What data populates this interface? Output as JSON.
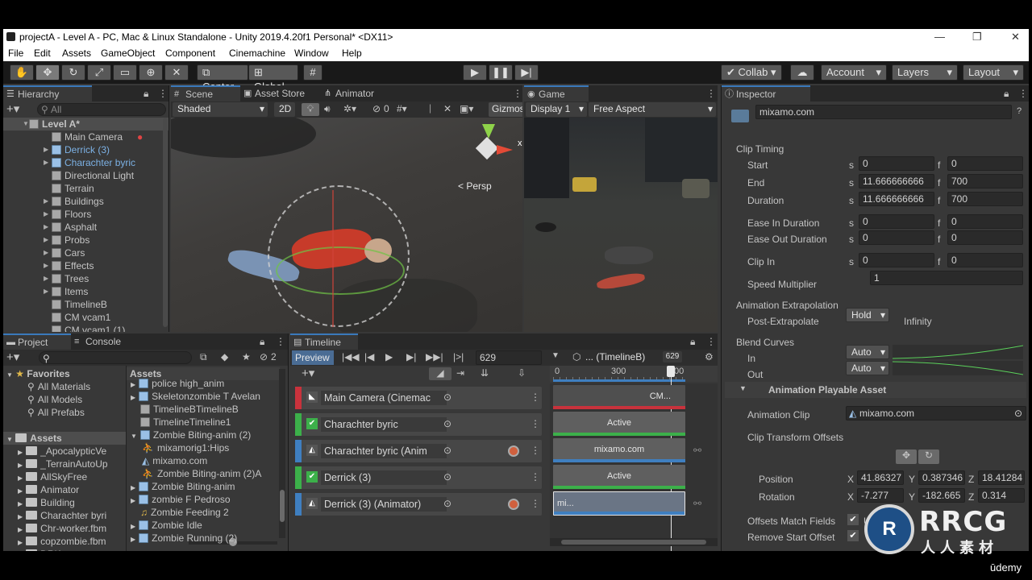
{
  "window": {
    "title": "projectA - Level A - PC, Mac & Linux Standalone - Unity 2019.4.20f1 Personal* <DX11>"
  },
  "menu": [
    "File",
    "Edit",
    "Assets",
    "GameObject",
    "Component",
    "Cinemachine",
    "Window",
    "Help"
  ],
  "toolbar": {
    "center": "Center",
    "global": "Global",
    "collab": "Collab",
    "account": "Account",
    "layers": "Layers",
    "layout": "Layout"
  },
  "hierarchy": {
    "tab": "Hierarchy",
    "search_placeholder": "All",
    "scene": "Level A*",
    "items": [
      {
        "label": "Main Camera",
        "type": "cam"
      },
      {
        "label": "Derrick (3)",
        "type": "prefab",
        "fold": true
      },
      {
        "label": "Charachter byric",
        "type": "prefab",
        "fold": true
      },
      {
        "label": "Directional Light",
        "type": "go"
      },
      {
        "label": "Terrain",
        "type": "go"
      },
      {
        "label": "Buildings",
        "type": "go",
        "fold": true
      },
      {
        "label": "Floors",
        "type": "go",
        "fold": true
      },
      {
        "label": "Asphalt",
        "type": "go",
        "fold": true
      },
      {
        "label": "Probs",
        "type": "go",
        "fold": true
      },
      {
        "label": "Cars",
        "type": "go",
        "fold": true
      },
      {
        "label": "Effects",
        "type": "go",
        "fold": true
      },
      {
        "label": "Trees",
        "type": "go",
        "fold": true
      },
      {
        "label": "Items",
        "type": "go",
        "fold": true
      },
      {
        "label": "TimelineB",
        "type": "go"
      },
      {
        "label": "CM vcam1",
        "type": "go"
      },
      {
        "label": "CM vcam1 (1)",
        "type": "go"
      }
    ]
  },
  "scene": {
    "tabs": [
      "Scene",
      "Asset Store",
      "Animator"
    ],
    "shading": "Shaded",
    "mode_2d": "2D",
    "hidden_count": "0",
    "gizmos": "Gizmos",
    "persp": "< Persp",
    "axis_y": "y",
    "axis_x": "x"
  },
  "game": {
    "tab": "Game",
    "display": "Display 1",
    "aspect": "Free Aspect"
  },
  "project": {
    "tabs": [
      "Project",
      "Console"
    ],
    "count": "2",
    "favorites_label": "Favorites",
    "favorites": [
      "All Materials",
      "All Models",
      "All Prefabs"
    ],
    "assets_root": "Assets",
    "tree": [
      "_ApocalypticVe",
      "_TerrainAutoUp",
      "AllSkyFree",
      "Animator",
      "Building",
      "Charachter byri",
      "Chr-worker.fbm",
      "copzombie.fbm",
      "DRK"
    ],
    "assets_header": "Assets",
    "assets": [
      "police high_anim",
      "Skeletonzombie T Avelan",
      "TimelineBTimelineB",
      "TimelineTimeline1",
      "Zombie Biting-anim (2)",
      "mixamorig1:Hips",
      "mixamo.com",
      "Zombie Biting-anim (2)A",
      "Zombie Biting-anim",
      "zombie F Pedroso",
      "Zombie Feeding 2",
      "Zombie Idle",
      "Zombie Running (2)"
    ]
  },
  "timeline": {
    "tab": "Timeline",
    "preview": "Preview",
    "frame": "629",
    "asset": "... (TimelineB)",
    "playhead": "629",
    "ruler": [
      "0",
      "300",
      "00"
    ],
    "tracks": [
      {
        "label": "Main Camera (Cinemac",
        "color": "#c8323c",
        "rec": false,
        "clip": "CM..."
      },
      {
        "label": "Charachter byric",
        "color": "#3cb04a",
        "rec": false,
        "clip": "Active"
      },
      {
        "label": "Charachter byric (Anim",
        "color": "#3f7fc0",
        "rec": true,
        "clip": "mixamo.com"
      },
      {
        "label": "Derrick (3)",
        "color": "#3cb04a",
        "rec": false,
        "clip": "Active"
      },
      {
        "label": "Derrick (3) (Animator)",
        "color": "#3f7fc0",
        "rec": true,
        "clip": "mi..."
      }
    ]
  },
  "inspector": {
    "tab": "Inspector",
    "name": "mixamo.com",
    "clip_timing": "Clip Timing",
    "start": {
      "label": "Start",
      "s": "0",
      "f": "0"
    },
    "end": {
      "label": "End",
      "s": "11.666666666",
      "f": "700"
    },
    "duration": {
      "label": "Duration",
      "s": "11.666666666",
      "f": "700"
    },
    "ease_in": {
      "label": "Ease In Duration",
      "s": "0",
      "f": "0"
    },
    "ease_out": {
      "label": "Ease Out Duration",
      "s": "0",
      "f": "0"
    },
    "clip_in": {
      "label": "Clip In",
      "s": "0",
      "f": "0"
    },
    "speed": {
      "label": "Speed Multiplier",
      "value": "1"
    },
    "extrap": "Animation Extrapolation",
    "post": {
      "label": "Post-Extrapolate",
      "value": "Hold",
      "extra": "Infinity"
    },
    "blend": "Blend Curves",
    "in": {
      "label": "In",
      "value": "Auto"
    },
    "out": {
      "label": "Out",
      "value": "Auto"
    },
    "playable": "Animation Playable Asset",
    "anim_clip": {
      "label": "Animation Clip",
      "value": "mixamo.com"
    },
    "offsets": "Clip Transform Offsets",
    "position": {
      "label": "Position",
      "x": "41.86327",
      "y": "0.387346",
      "z": "18.41284"
    },
    "rotation": {
      "label": "Rotation",
      "x": "-7.277",
      "y": "-182.665",
      "z": "0.314"
    },
    "match": {
      "label": "Offsets Match Fields",
      "value": "Us"
    },
    "remove": {
      "label": "Remove Start Offset"
    },
    "s": "s",
    "f": "f",
    "X": "X",
    "Y": "Y",
    "Z": "Z"
  },
  "watermark": {
    "text": "RRCG",
    "sub": "人人素材",
    "udemy": "ūdemy"
  }
}
